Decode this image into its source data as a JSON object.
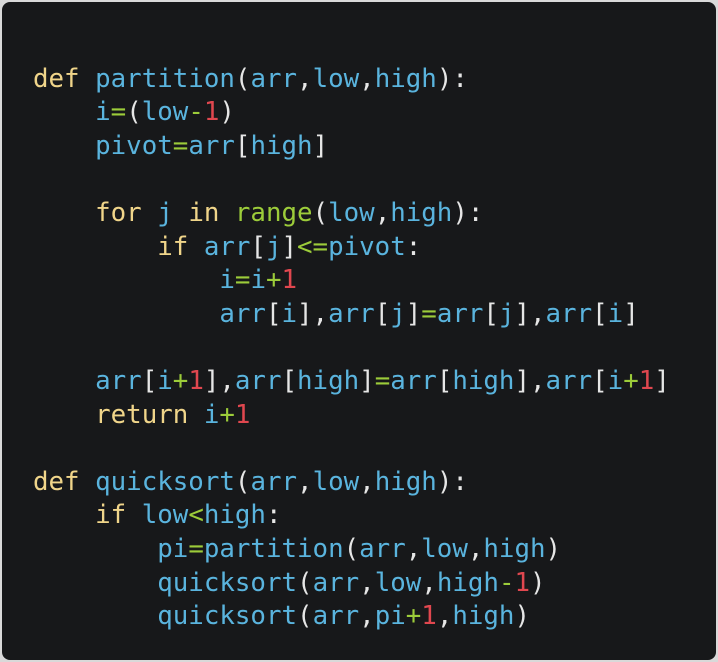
{
  "code": {
    "lines": [
      [],
      [
        {
          "t": "def",
          "c": "kw"
        },
        {
          "t": " ",
          "c": "punc"
        },
        {
          "t": "partition",
          "c": "fn"
        },
        {
          "t": "(",
          "c": "punc"
        },
        {
          "t": "arr",
          "c": "id"
        },
        {
          "t": ",",
          "c": "punc"
        },
        {
          "t": "low",
          "c": "id"
        },
        {
          "t": ",",
          "c": "punc"
        },
        {
          "t": "high",
          "c": "id"
        },
        {
          "t": "):",
          "c": "punc"
        }
      ],
      [
        {
          "t": "    ",
          "c": "punc"
        },
        {
          "t": "i",
          "c": "id"
        },
        {
          "t": "=",
          "c": "op"
        },
        {
          "t": "(",
          "c": "punc"
        },
        {
          "t": "low",
          "c": "id"
        },
        {
          "t": "-",
          "c": "op"
        },
        {
          "t": "1",
          "c": "num"
        },
        {
          "t": ")",
          "c": "punc"
        }
      ],
      [
        {
          "t": "    ",
          "c": "punc"
        },
        {
          "t": "pivot",
          "c": "id"
        },
        {
          "t": "=",
          "c": "op"
        },
        {
          "t": "arr",
          "c": "id"
        },
        {
          "t": "[",
          "c": "punc"
        },
        {
          "t": "high",
          "c": "id"
        },
        {
          "t": "]",
          "c": "punc"
        }
      ],
      [],
      [
        {
          "t": "    ",
          "c": "punc"
        },
        {
          "t": "for",
          "c": "kw"
        },
        {
          "t": " ",
          "c": "punc"
        },
        {
          "t": "j",
          "c": "id"
        },
        {
          "t": " ",
          "c": "punc"
        },
        {
          "t": "in",
          "c": "kw"
        },
        {
          "t": " ",
          "c": "punc"
        },
        {
          "t": "range",
          "c": "call"
        },
        {
          "t": "(",
          "c": "punc"
        },
        {
          "t": "low",
          "c": "id"
        },
        {
          "t": ",",
          "c": "punc"
        },
        {
          "t": "high",
          "c": "id"
        },
        {
          "t": "):",
          "c": "punc"
        }
      ],
      [
        {
          "t": "        ",
          "c": "punc"
        },
        {
          "t": "if",
          "c": "kw"
        },
        {
          "t": " ",
          "c": "punc"
        },
        {
          "t": "arr",
          "c": "id"
        },
        {
          "t": "[",
          "c": "punc"
        },
        {
          "t": "j",
          "c": "id"
        },
        {
          "t": "]",
          "c": "punc"
        },
        {
          "t": "<=",
          "c": "op"
        },
        {
          "t": "pivot",
          "c": "id"
        },
        {
          "t": ":",
          "c": "punc"
        }
      ],
      [
        {
          "t": "            ",
          "c": "punc"
        },
        {
          "t": "i",
          "c": "id"
        },
        {
          "t": "=",
          "c": "op"
        },
        {
          "t": "i",
          "c": "id"
        },
        {
          "t": "+",
          "c": "op"
        },
        {
          "t": "1",
          "c": "num"
        }
      ],
      [
        {
          "t": "            ",
          "c": "punc"
        },
        {
          "t": "arr",
          "c": "id"
        },
        {
          "t": "[",
          "c": "punc"
        },
        {
          "t": "i",
          "c": "id"
        },
        {
          "t": "],",
          "c": "punc"
        },
        {
          "t": "arr",
          "c": "id"
        },
        {
          "t": "[",
          "c": "punc"
        },
        {
          "t": "j",
          "c": "id"
        },
        {
          "t": "]",
          "c": "punc"
        },
        {
          "t": "=",
          "c": "op"
        },
        {
          "t": "arr",
          "c": "id"
        },
        {
          "t": "[",
          "c": "punc"
        },
        {
          "t": "j",
          "c": "id"
        },
        {
          "t": "],",
          "c": "punc"
        },
        {
          "t": "arr",
          "c": "id"
        },
        {
          "t": "[",
          "c": "punc"
        },
        {
          "t": "i",
          "c": "id"
        },
        {
          "t": "]",
          "c": "punc"
        }
      ],
      [],
      [
        {
          "t": "    ",
          "c": "punc"
        },
        {
          "t": "arr",
          "c": "id"
        },
        {
          "t": "[",
          "c": "punc"
        },
        {
          "t": "i",
          "c": "id"
        },
        {
          "t": "+",
          "c": "op"
        },
        {
          "t": "1",
          "c": "num"
        },
        {
          "t": "],",
          "c": "punc"
        },
        {
          "t": "arr",
          "c": "id"
        },
        {
          "t": "[",
          "c": "punc"
        },
        {
          "t": "high",
          "c": "id"
        },
        {
          "t": "]",
          "c": "punc"
        },
        {
          "t": "=",
          "c": "op"
        },
        {
          "t": "arr",
          "c": "id"
        },
        {
          "t": "[",
          "c": "punc"
        },
        {
          "t": "high",
          "c": "id"
        },
        {
          "t": "],",
          "c": "punc"
        },
        {
          "t": "arr",
          "c": "id"
        },
        {
          "t": "[",
          "c": "punc"
        },
        {
          "t": "i",
          "c": "id"
        },
        {
          "t": "+",
          "c": "op"
        },
        {
          "t": "1",
          "c": "num"
        },
        {
          "t": "]",
          "c": "punc"
        }
      ],
      [
        {
          "t": "    ",
          "c": "punc"
        },
        {
          "t": "return",
          "c": "kw"
        },
        {
          "t": " ",
          "c": "punc"
        },
        {
          "t": "i",
          "c": "id"
        },
        {
          "t": "+",
          "c": "op"
        },
        {
          "t": "1",
          "c": "num"
        }
      ],
      [],
      [
        {
          "t": "def",
          "c": "kw"
        },
        {
          "t": " ",
          "c": "punc"
        },
        {
          "t": "quicksort",
          "c": "fn"
        },
        {
          "t": "(",
          "c": "punc"
        },
        {
          "t": "arr",
          "c": "id"
        },
        {
          "t": ",",
          "c": "punc"
        },
        {
          "t": "low",
          "c": "id"
        },
        {
          "t": ",",
          "c": "punc"
        },
        {
          "t": "high",
          "c": "id"
        },
        {
          "t": "):",
          "c": "punc"
        }
      ],
      [
        {
          "t": "    ",
          "c": "punc"
        },
        {
          "t": "if",
          "c": "kw"
        },
        {
          "t": " ",
          "c": "punc"
        },
        {
          "t": "low",
          "c": "id"
        },
        {
          "t": "<",
          "c": "op"
        },
        {
          "t": "high",
          "c": "id"
        },
        {
          "t": ":",
          "c": "punc"
        }
      ],
      [
        {
          "t": "        ",
          "c": "punc"
        },
        {
          "t": "pi",
          "c": "id"
        },
        {
          "t": "=",
          "c": "op"
        },
        {
          "t": "partition",
          "c": "id"
        },
        {
          "t": "(",
          "c": "punc"
        },
        {
          "t": "arr",
          "c": "id"
        },
        {
          "t": ",",
          "c": "punc"
        },
        {
          "t": "low",
          "c": "id"
        },
        {
          "t": ",",
          "c": "punc"
        },
        {
          "t": "high",
          "c": "id"
        },
        {
          "t": ")",
          "c": "punc"
        }
      ],
      [
        {
          "t": "        ",
          "c": "punc"
        },
        {
          "t": "quicksort",
          "c": "id"
        },
        {
          "t": "(",
          "c": "punc"
        },
        {
          "t": "arr",
          "c": "id"
        },
        {
          "t": ",",
          "c": "punc"
        },
        {
          "t": "low",
          "c": "id"
        },
        {
          "t": ",",
          "c": "punc"
        },
        {
          "t": "high",
          "c": "id"
        },
        {
          "t": "-",
          "c": "op"
        },
        {
          "t": "1",
          "c": "num"
        },
        {
          "t": ")",
          "c": "punc"
        }
      ],
      [
        {
          "t": "        ",
          "c": "punc"
        },
        {
          "t": "quicksort",
          "c": "id"
        },
        {
          "t": "(",
          "c": "punc"
        },
        {
          "t": "arr",
          "c": "id"
        },
        {
          "t": ",",
          "c": "punc"
        },
        {
          "t": "pi",
          "c": "id"
        },
        {
          "t": "+",
          "c": "op"
        },
        {
          "t": "1",
          "c": "num"
        },
        {
          "t": ",",
          "c": "punc"
        },
        {
          "t": "high",
          "c": "id"
        },
        {
          "t": ")",
          "c": "punc"
        }
      ]
    ]
  },
  "colors": {
    "background": "#17181a",
    "keyword": "#f0d58a",
    "identifier": "#5ab4de",
    "number": "#e0474f",
    "operator": "#9ccc3a",
    "punctuation": "#e6e6e6"
  }
}
